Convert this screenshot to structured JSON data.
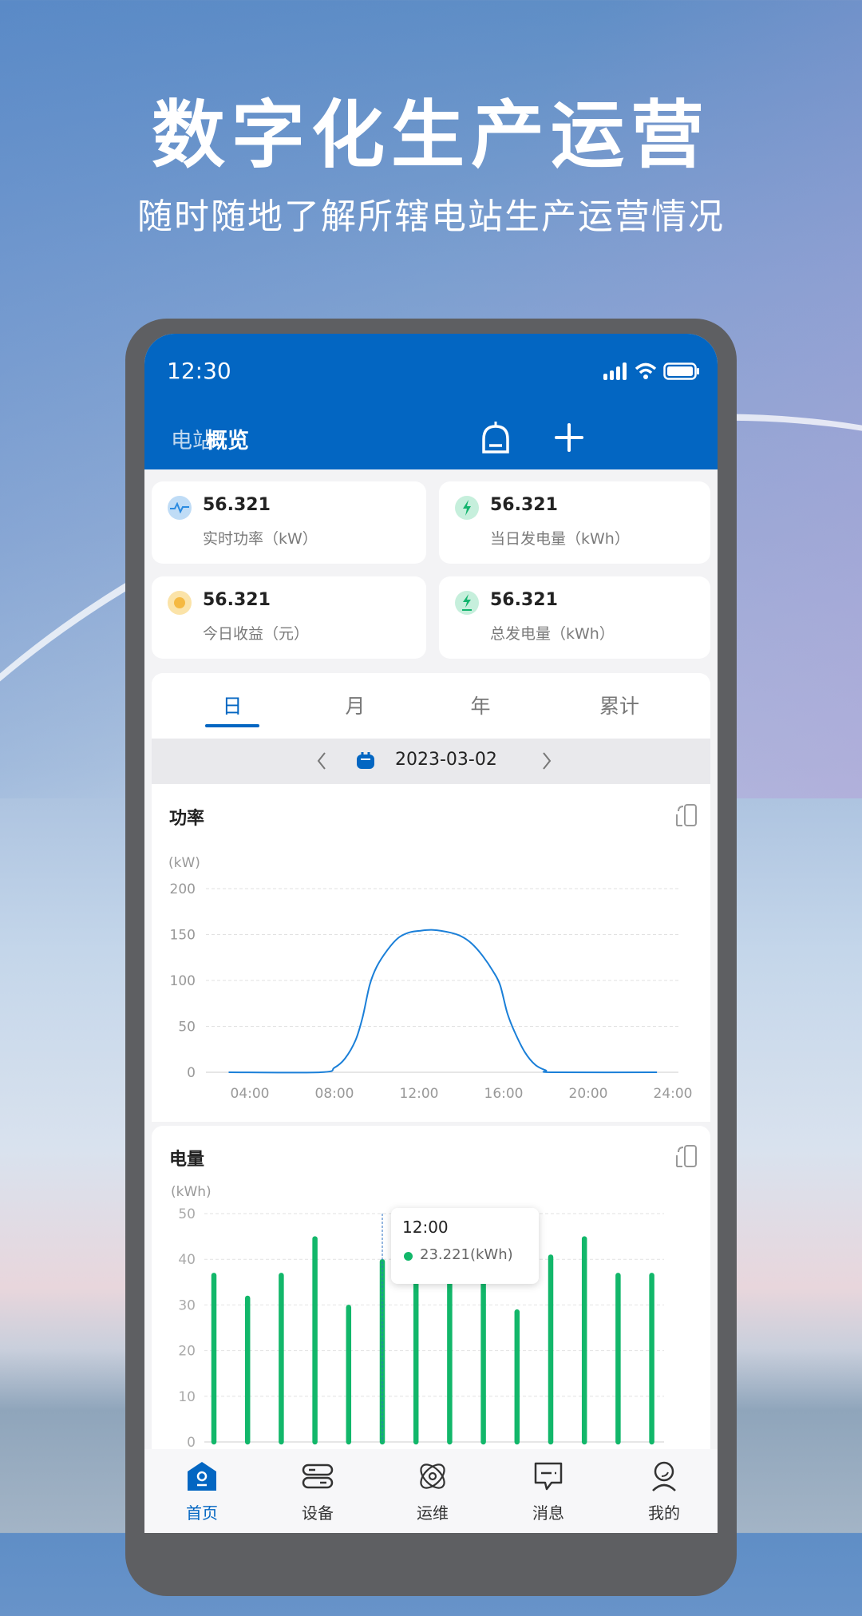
{
  "hero": {
    "title": "数字化生产运营",
    "subtitle": "随时随地了解所辖电站生产运营情况"
  },
  "status_bar": {
    "time": "12:30"
  },
  "header": {
    "tabs": [
      {
        "label": "电站",
        "active": false
      },
      {
        "label": "概览",
        "active": true
      }
    ],
    "icons": [
      "bell-icon",
      "plus-icon"
    ]
  },
  "stats": [
    {
      "value": "56.321",
      "label": "实时功率（kW）",
      "icon": "pulse-icon",
      "color": "#2b8be0"
    },
    {
      "value": "56.321",
      "label": "当日发电量（kWh）",
      "icon": "lightning-icon",
      "color": "#14b46e"
    },
    {
      "value": "56.321",
      "label": "今日收益（元）",
      "icon": "sun-icon",
      "color": "#f5b942"
    },
    {
      "value": "56.321",
      "label": "总发电量（kWh）",
      "icon": "lightning-total-icon",
      "color": "#14b46e"
    }
  ],
  "period_tabs": [
    {
      "label": "日",
      "active": true
    },
    {
      "label": "月"
    },
    {
      "label": "年"
    },
    {
      "label": "累计"
    }
  ],
  "date_picker": {
    "date": "2023-03-02"
  },
  "power_chart": {
    "title": "功率"
  },
  "energy_chart": {
    "title": "电量",
    "tooltip": {
      "time": "12:00",
      "value": "23.221(kWh)"
    }
  },
  "chart_data": [
    {
      "type": "line",
      "unit": "(kW)",
      "ylim": [
        0,
        200
      ],
      "yticks": [
        "200",
        "150",
        "100",
        "50",
        "0"
      ],
      "xticks": [
        "04:00",
        "08:00",
        "12:00",
        "16:00",
        "20:00",
        "24:00"
      ],
      "color": "#1a7fd8",
      "grid": true,
      "x": [
        "03:00",
        "07:20",
        "08:00",
        "08:30",
        "09:00",
        "09:20",
        "09:40",
        "10:00",
        "10:30",
        "11:00",
        "11:30",
        "12:00",
        "12:40",
        "13:30",
        "14:00",
        "14:30",
        "15:00",
        "15:30",
        "15:50",
        "16:10",
        "16:30",
        "17:00",
        "17:30",
        "18:00",
        "18:20",
        "23:15"
      ],
      "y": [
        0,
        0,
        5,
        15,
        35,
        60,
        95,
        115,
        133,
        146,
        152,
        154,
        155,
        152,
        148,
        140,
        127,
        110,
        95,
        65,
        45,
        22,
        8,
        2,
        0,
        0
      ]
    },
    {
      "type": "bar",
      "unit": "(kWh)",
      "ylim": [
        0,
        50
      ],
      "yticks": [
        "50",
        "40",
        "30",
        "20",
        "10",
        "0"
      ],
      "color": "#12b76a",
      "grid": true,
      "highlight_index": 5,
      "values": [
        37,
        32,
        37,
        45,
        30,
        40,
        38,
        37,
        36,
        29,
        41,
        45,
        37,
        37
      ]
    }
  ],
  "nav": [
    {
      "label": "首页",
      "icon": "home-icon",
      "active": true
    },
    {
      "label": "设备",
      "icon": "device-icon"
    },
    {
      "label": "运维",
      "icon": "maintenance-icon"
    },
    {
      "label": "消息",
      "icon": "message-icon"
    },
    {
      "label": "我的",
      "icon": "profile-icon"
    }
  ]
}
